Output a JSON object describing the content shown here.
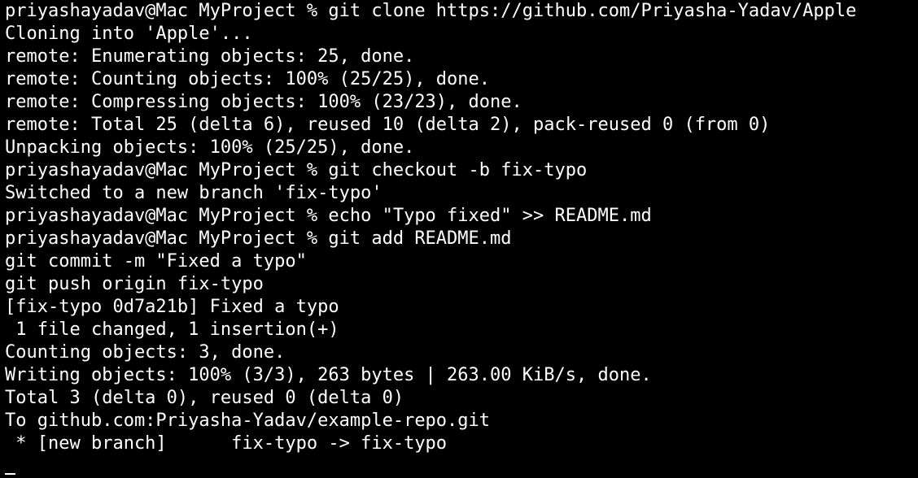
{
  "terminal": {
    "lines": [
      {
        "text": "priyashayadav@Mac MyProject % git clone https://github.com/Priyasha-Yadav/Apple",
        "marked": true
      },
      {
        "text": "Cloning into 'Apple'...",
        "marked": false
      },
      {
        "text": "remote: Enumerating objects: 25, done.",
        "marked": false
      },
      {
        "text": "remote: Counting objects: 100% (25/25), done.",
        "marked": false
      },
      {
        "text": "remote: Compressing objects: 100% (23/23), done.",
        "marked": false
      },
      {
        "text": "remote: Total 25 (delta 6), reused 10 (delta 2), pack-reused 0 (from 0)",
        "marked": false
      },
      {
        "text": "Unpacking objects: 100% (25/25), done.",
        "marked": false
      },
      {
        "text": "priyashayadav@Mac MyProject % git checkout -b fix-typo",
        "marked": true
      },
      {
        "text": "Switched to a new branch 'fix-typo'",
        "marked": false
      },
      {
        "text": "priyashayadav@Mac MyProject % echo \"Typo fixed\" >> README.md",
        "marked": true
      },
      {
        "text": "priyashayadav@Mac MyProject % git add README.md",
        "marked": false
      },
      {
        "text": "git commit -m \"Fixed a typo\"",
        "marked": false
      },
      {
        "text": "git push origin fix-typo",
        "marked": true
      },
      {
        "text": "[fix-typo 0d7a21b] Fixed a typo",
        "marked": false
      },
      {
        "text": " 1 file changed, 1 insertion(+)",
        "marked": false
      },
      {
        "text": "Counting objects: 3, done.",
        "marked": false
      },
      {
        "text": "Writing objects: 100% (3/3), 263 bytes | 263.00 KiB/s, done.",
        "marked": false
      },
      {
        "text": "Total 3 (delta 0), reused 0 (delta 0)",
        "marked": false
      },
      {
        "text": "To github.com:Priyasha-Yadav/example-repo.git",
        "marked": false
      },
      {
        "text": " * [new branch]      fix-typo -> fix-typo",
        "marked": false
      }
    ]
  },
  "colors": {
    "background": "#000000",
    "text": "#ffffff",
    "mark": "#9a9a9a"
  }
}
